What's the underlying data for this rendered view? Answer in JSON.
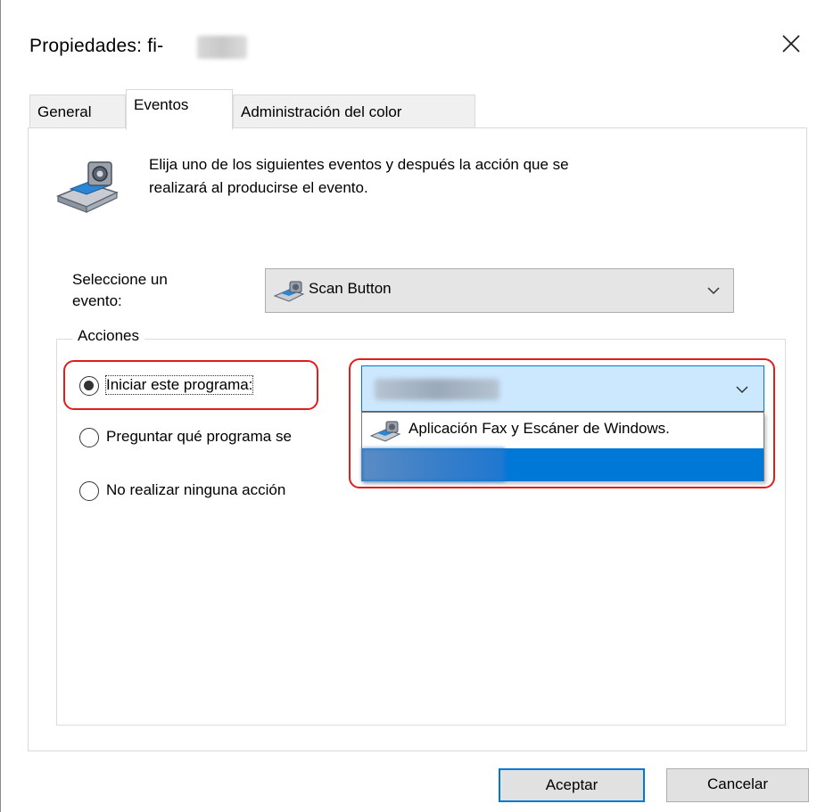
{
  "window": {
    "title": "Propiedades: fi-"
  },
  "tabs": [
    {
      "label": "General"
    },
    {
      "label": "Eventos"
    },
    {
      "label": "Administración del color"
    }
  ],
  "description": {
    "line1": "Elija uno de los siguientes eventos y después la acción que se",
    "line2": "realizará al producirse el evento."
  },
  "event": {
    "label_line1": "Seleccione un",
    "label_line2": "evento:",
    "selected": "Scan Button"
  },
  "actions": {
    "legend": "Acciones",
    "options": [
      {
        "label": "Iniciar este programa:",
        "checked": true
      },
      {
        "label": "Preguntar qué programa se",
        "checked": false
      },
      {
        "label": "No realizar ninguna acción",
        "checked": false
      }
    ],
    "program_dropdown": {
      "items": [
        {
          "label": "Aplicación Fax y Escáner de Windows."
        }
      ]
    }
  },
  "buttons": {
    "ok": "Aceptar",
    "cancel": "Cancelar"
  },
  "colors": {
    "highlight": "#e21b1b",
    "accent": "#0078d7"
  },
  "icons": [
    "close-icon",
    "scanner-icon",
    "scan-button-icon",
    "chevron-down-icon",
    "fax-scan-icon"
  ]
}
